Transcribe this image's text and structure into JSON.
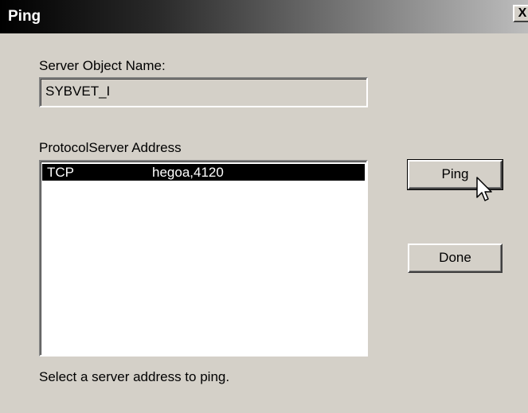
{
  "window": {
    "title": "Ping",
    "close_glyph": "X"
  },
  "server_object": {
    "label": "Server Object Name:",
    "value": "SYBVET_I"
  },
  "address_list": {
    "header_label": "ProtocolServer Address",
    "rows": [
      {
        "protocol": "TCP",
        "address": "hegoa,4120",
        "selected": true
      }
    ]
  },
  "buttons": {
    "ping_label": "Ping",
    "done_label": "Done"
  },
  "status": {
    "hint": "Select a server address to ping."
  },
  "icons": {
    "cursor": "arrow-cursor-icon",
    "close": "close-icon"
  }
}
